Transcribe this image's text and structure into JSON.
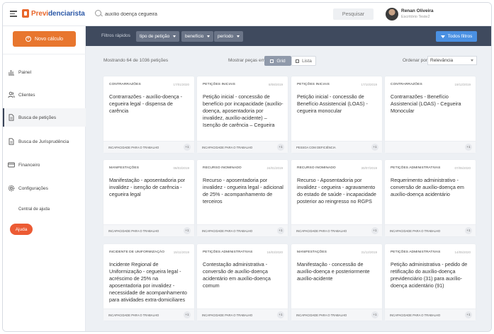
{
  "app": {
    "brand_part1": "Previ",
    "brand_part2": "denciarista"
  },
  "search": {
    "value": "auxílio doença cegueira",
    "button": "Pesquisar"
  },
  "user": {
    "name": "Renan Oliveira",
    "office": "Escritório Teste2"
  },
  "sidebar": {
    "new_button": "Novo cálculo",
    "items": [
      {
        "label": "Painel",
        "icon": "bar-chart-icon"
      },
      {
        "label": "Clientes",
        "icon": "users-icon"
      },
      {
        "label": "Busca de petições",
        "icon": "document-icon",
        "active": true
      },
      {
        "label": "Busca de Jurisprudência",
        "icon": "document-icon"
      },
      {
        "label": "Financeiro",
        "icon": "card-icon"
      },
      {
        "label": "Configurações",
        "icon": "gear-icon"
      }
    ],
    "help_link": "Central de ajuda",
    "help_button": "Ajuda"
  },
  "filters": {
    "label": "Filtros rápidos",
    "chips": [
      "tipo de petição",
      "benefício",
      "período"
    ],
    "all_button": "Todos filtros"
  },
  "toolbar": {
    "results": "Mostrando 64 de 1036 petições",
    "view_label": "Mostrar peças em",
    "grid": "Grid",
    "list": "Lista",
    "order_label": "Ordenar por",
    "order_value": "Relevância"
  },
  "colors": {
    "brand_orange": "#e8762e",
    "brand_blue": "#2e5aa8",
    "filter_bar": "#3f4a5e",
    "accent_blue": "#4a90e2",
    "help_red": "#ec5b34"
  },
  "cards": [
    {
      "category": "Contrarrazões",
      "date": "17/01/2020",
      "title": "Contrarrazões - auxílio-doença - cegueira legal - dispensa de carência",
      "tag": "Incapacidade para o trabalho",
      "count": "+1"
    },
    {
      "category": "Petições iniciais",
      "date": "8/08/2019",
      "title": "Petição inicial - concessão de benefício por incapacidade (auxílio-doença, aposentadoria por invalidez, auxílio-acidente) – Isenção de carência – Cegueira",
      "tag": "Incapacidade para o trabalho",
      "count": "+1"
    },
    {
      "category": "Petições iniciais",
      "date": "17/10/2019",
      "title": "Petição inicial - concessão de Benefício Assistencial (LOAS) - cegueira monocular",
      "tag": "Pessoa com deficiência",
      "count": "+1"
    },
    {
      "category": "Contrarrazões",
      "date": "19/12/2019",
      "title": "Contrarrazões - Benefício Assistencial (LOAS) - Cegueira Monocular",
      "tag": "",
      "count": "+1"
    },
    {
      "category": "Manifestações",
      "date": "08/03/2019",
      "title": "Manifestação - aposentadoria por invalidez - isenção de carência - cegueira legal",
      "tag": "Incapacidade para o trabalho",
      "count": "+1"
    },
    {
      "category": "Recurso inominado",
      "date": "24/01/2019",
      "title": "Recurso - aposentadoria por invalidez - cegueira legal - adicional de 25% - acompanhamento de terceiros",
      "tag": "Incapacidade para o trabalho",
      "count": "+1"
    },
    {
      "category": "Recurso inominado",
      "date": "30/07/2019",
      "title": "Recurso - Aposentadoria por invalidez - cegueira - agravamento do estado de saúde - incapacidade posterior ao reingresso no RGPS",
      "tag": "Incapacidade para o trabalho",
      "count": "+1"
    },
    {
      "category": "Petições administrativas",
      "date": "07/05/2020",
      "title": "Requerimento administrativo - conversão de auxílio-doença em auxílio-doença acidentário",
      "tag": "Incapacidade para o trabalho",
      "count": "+1"
    },
    {
      "category": "Incidente de Uniformização",
      "date": "15/11/2019",
      "title": "Incidente Regional de Uniformização - cegueira legal - acréscimo de 25% na aposentadoria por invalidez - necessidade de acompanhamento para atividades extra-domiciliares",
      "tag": "Incapacidade para o trabalho",
      "count": "+1"
    },
    {
      "category": "Petições administrativas",
      "date": "16/03/2020",
      "title": "Contestação administrativa - conversão de auxílio-doença acidentário em auxílio-doença comum",
      "tag": "Incapacidade para o trabalho",
      "count": "+1"
    },
    {
      "category": "Manifestações",
      "date": "31/12/2019",
      "title": "Manifestação - concessão de auxílio-doença e posteriormente auxílio-acidente",
      "tag": "Incapacidade para o trabalho",
      "count": "+1"
    },
    {
      "category": "Petições administrativas",
      "date": "14/05/2020",
      "title": "Petição administrativa - pedido de retificação do auxílio-doença previdenciário (31) para auxílio-doença acidentário (91)",
      "tag": "Incapacidade para o trabalho",
      "count": "+1"
    }
  ]
}
